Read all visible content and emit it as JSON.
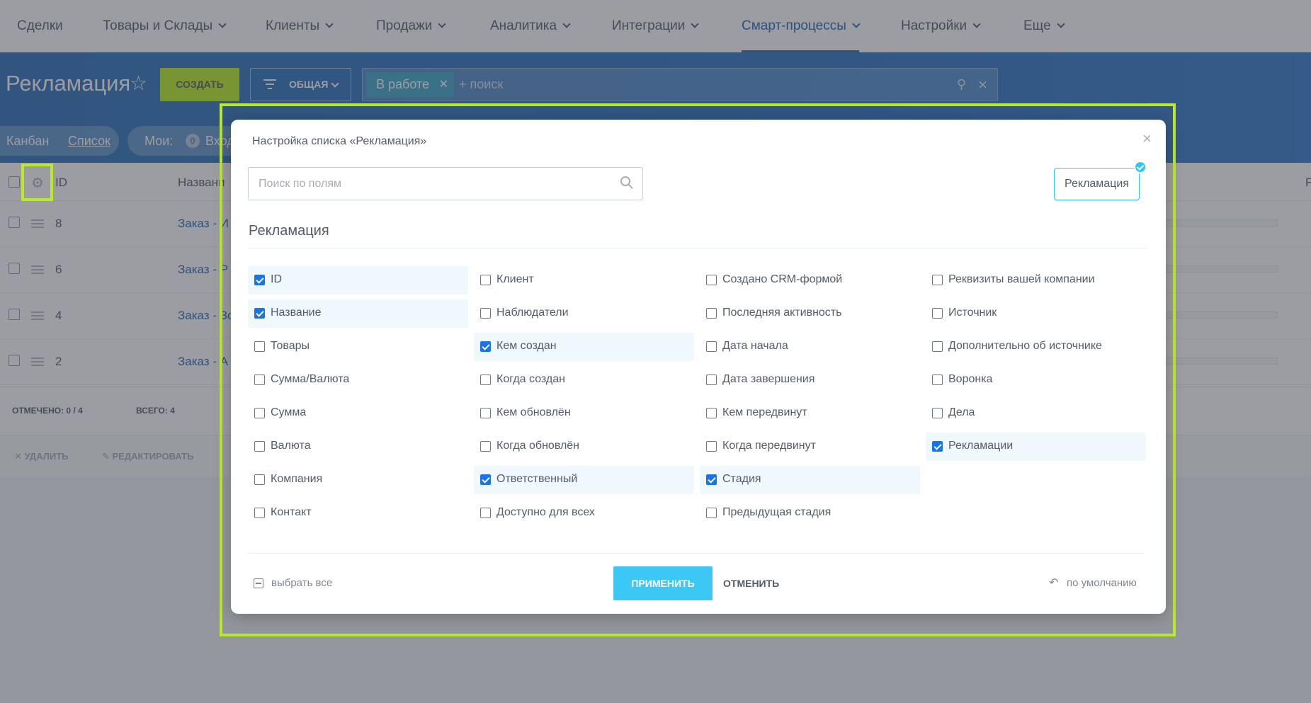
{
  "topnav": {
    "items": [
      {
        "label": "Сделки",
        "has_menu": false,
        "active": false
      },
      {
        "label": "Товары и Склады",
        "has_menu": true,
        "active": false
      },
      {
        "label": "Клиенты",
        "has_menu": true,
        "active": false
      },
      {
        "label": "Продажи",
        "has_menu": true,
        "active": false
      },
      {
        "label": "Аналитика",
        "has_menu": true,
        "active": false
      },
      {
        "label": "Интеграции",
        "has_menu": true,
        "active": false
      },
      {
        "label": "Смарт-процессы",
        "has_menu": true,
        "active": true
      },
      {
        "label": "Настройки",
        "has_menu": true,
        "active": false
      },
      {
        "label": "Еще",
        "has_menu": true,
        "active": false
      }
    ]
  },
  "header": {
    "title": "Рекламация",
    "create_label": "СОЗДАТЬ",
    "filter_label": "ОБЩАЯ",
    "search_tag": "В работе",
    "search_placeholder": "+ поиск"
  },
  "views": {
    "kanban": "Канбан",
    "list": "Список",
    "mine_label": "Мои:",
    "mine_count": "0",
    "mine_incoming": "Вход"
  },
  "grid": {
    "col_id": "ID",
    "col_name": "Названи",
    "col_right": "Р",
    "rows": [
      {
        "id": "8",
        "name": "Заказ - И",
        "progress": 0.2
      },
      {
        "id": "6",
        "name": "Заказ - Р",
        "progress": 0
      },
      {
        "id": "4",
        "name": "Заказ - Зо",
        "progress": 0
      },
      {
        "id": "2",
        "name": "Заказ - А",
        "progress": 0
      }
    ],
    "selected": "ОТМЕЧЕНО: 0 / 4",
    "total": "ВСЕГО: 4",
    "delete_label": "✕ УДАЛИТЬ",
    "edit_label": "✎ РЕДАКТИРОВАТЬ"
  },
  "popup": {
    "title": "Настройка списка «Рекламация»",
    "search_placeholder": "Поиск по полям",
    "section_button": "Рекламация",
    "section_heading": "Рекламация",
    "columns": [
      [
        {
          "label": "ID",
          "checked": true
        },
        {
          "label": "Название",
          "checked": true
        },
        {
          "label": "Товары",
          "checked": false
        },
        {
          "label": "Сумма/Валюта",
          "checked": false
        },
        {
          "label": "Сумма",
          "checked": false
        },
        {
          "label": "Валюта",
          "checked": false
        },
        {
          "label": "Компания",
          "checked": false
        },
        {
          "label": "Контакт",
          "checked": false
        }
      ],
      [
        {
          "label": "Клиент",
          "checked": false
        },
        {
          "label": "Наблюдатели",
          "checked": false
        },
        {
          "label": "Кем создан",
          "checked": true
        },
        {
          "label": "Когда создан",
          "checked": false
        },
        {
          "label": "Кем обновлён",
          "checked": false
        },
        {
          "label": "Когда обновлён",
          "checked": false
        },
        {
          "label": "Ответственный",
          "checked": true
        },
        {
          "label": "Доступно для всех",
          "checked": false
        }
      ],
      [
        {
          "label": "Создано CRM-формой",
          "checked": false
        },
        {
          "label": "Последняя активность",
          "checked": false
        },
        {
          "label": "Дата начала",
          "checked": false
        },
        {
          "label": "Дата завершения",
          "checked": false
        },
        {
          "label": "Кем передвинут",
          "checked": false
        },
        {
          "label": "Когда передвинут",
          "checked": false
        },
        {
          "label": "Стадия",
          "checked": true
        },
        {
          "label": "Предыдущая стадия",
          "checked": false
        }
      ],
      [
        {
          "label": "Реквизиты вашей компании",
          "checked": false
        },
        {
          "label": "Источник",
          "checked": false
        },
        {
          "label": "Дополнительно об источнике",
          "checked": false
        },
        {
          "label": "Воронка",
          "checked": false
        },
        {
          "label": "Дела",
          "checked": false
        },
        {
          "label": "Рекламации",
          "checked": true
        }
      ]
    ],
    "select_all": "выбрать все",
    "apply": "ПРИМЕНИТЬ",
    "cancel": "ОТМЕНИТЬ",
    "reset": "по умолчанию"
  },
  "colors": {
    "accent_green": "#bbed21",
    "highlight": "#b9ea2a",
    "apply_blue": "#3bc8f5",
    "nav_active": "#2067b0",
    "checkbox_blue": "#1a73e8"
  }
}
